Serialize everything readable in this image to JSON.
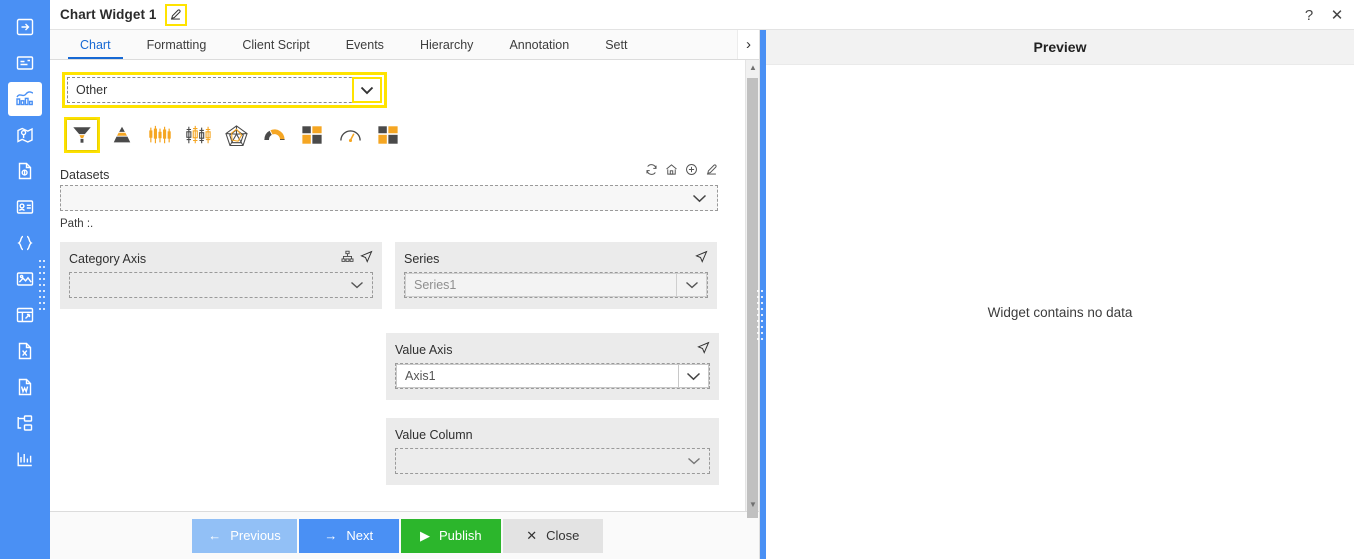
{
  "window": {
    "title": "Chart Widget 1",
    "edit_icon": "edit-pencil-icon",
    "help_label": "?",
    "close_label": "✕"
  },
  "rail": {
    "items": [
      {
        "name": "rail-item-export",
        "icon": "export-arrow-icon",
        "active": false
      },
      {
        "name": "rail-item-form",
        "icon": "form-panel-icon",
        "active": false
      },
      {
        "name": "rail-item-chart",
        "icon": "chart-widget-icon",
        "active": true
      },
      {
        "name": "rail-item-map",
        "icon": "map-pin-icon",
        "active": false
      },
      {
        "name": "rail-item-report",
        "icon": "report-doc-icon",
        "active": false
      },
      {
        "name": "rail-item-card",
        "icon": "id-card-icon",
        "active": false
      },
      {
        "name": "rail-item-code",
        "icon": "curly-braces-icon",
        "active": false
      },
      {
        "name": "rail-item-image",
        "icon": "image-icon",
        "active": false
      },
      {
        "name": "rail-item-grid",
        "icon": "grid-table-icon",
        "active": false
      },
      {
        "name": "rail-item-excel",
        "icon": "excel-file-icon",
        "active": false
      },
      {
        "name": "rail-item-word",
        "icon": "word-file-icon",
        "active": false
      },
      {
        "name": "rail-item-tree",
        "icon": "tree-structure-icon",
        "active": false
      },
      {
        "name": "rail-item-analytics",
        "icon": "analytics-bars-icon",
        "active": false
      }
    ]
  },
  "tabs": {
    "items": [
      {
        "label": "Chart",
        "active": true
      },
      {
        "label": "Formatting",
        "active": false
      },
      {
        "label": "Client Script",
        "active": false
      },
      {
        "label": "Events",
        "active": false
      },
      {
        "label": "Hierarchy",
        "active": false
      },
      {
        "label": "Annotation",
        "active": false
      },
      {
        "label": "Sett",
        "active": false
      }
    ],
    "more_label": "›"
  },
  "chart_type": {
    "selected_label": "Other",
    "dropdown_icon": "chevron-down-icon",
    "icons": [
      {
        "name": "funnel-chart-icon",
        "selected": true
      },
      {
        "name": "pyramid-chart-icon",
        "selected": false
      },
      {
        "name": "candlestick-chart-icon",
        "selected": false
      },
      {
        "name": "boxplot-chart-icon",
        "selected": false
      },
      {
        "name": "radar-chart-icon",
        "selected": false
      },
      {
        "name": "semi-gauge-chart-icon",
        "selected": false
      },
      {
        "name": "treemap-chart-icon",
        "selected": false
      },
      {
        "name": "dial-gauge-chart-icon",
        "selected": false
      },
      {
        "name": "mosaic-chart-icon",
        "selected": false
      }
    ]
  },
  "datasets": {
    "label": "Datasets",
    "value": "",
    "actions": [
      {
        "name": "refresh-icon"
      },
      {
        "name": "home-icon"
      },
      {
        "name": "add-circle-icon"
      },
      {
        "name": "edit-pencil-icon"
      }
    ],
    "path_label": "Path :."
  },
  "category_axis": {
    "title": "Category Axis",
    "value": "",
    "icons": [
      {
        "name": "hierarchy-tree-icon"
      },
      {
        "name": "send-arrow-icon"
      }
    ]
  },
  "series": {
    "title": "Series",
    "value": "Series1",
    "icons": [
      {
        "name": "send-arrow-icon"
      }
    ]
  },
  "value_axis": {
    "title": "Value Axis",
    "value": "Axis1",
    "icons": [
      {
        "name": "send-arrow-icon"
      }
    ]
  },
  "value_column": {
    "title": "Value Column",
    "value": ""
  },
  "footer": {
    "previous_label": "Previous",
    "next_label": "Next",
    "publish_label": "Publish",
    "close_label": "Close"
  },
  "preview": {
    "title": "Preview",
    "empty_message": "Widget contains no data"
  },
  "colors": {
    "accent_blue": "#4a90f4",
    "highlight_yellow": "#ffe300",
    "publish_green": "#2cb62c",
    "chart_orange": "#f5a623",
    "chart_dark": "#4a4a4a"
  }
}
